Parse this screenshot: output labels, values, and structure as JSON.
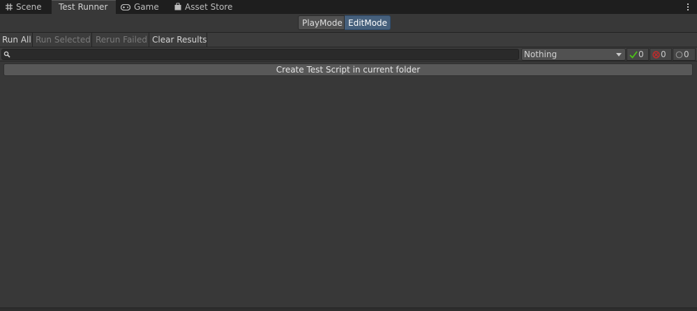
{
  "tabs": [
    {
      "label": "Scene",
      "icon": "grid-icon",
      "active": false
    },
    {
      "label": "Test Runner",
      "icon": "",
      "active": true
    },
    {
      "label": "Game",
      "icon": "gamepad-icon",
      "active": false
    },
    {
      "label": "Asset Store",
      "icon": "shopping-bag-icon",
      "active": false
    }
  ],
  "modes": {
    "playmode_label": "PlayMode",
    "editmode_label": "EditMode",
    "selected": "EditMode"
  },
  "toolbar": {
    "run_all": "Run All",
    "run_selected": "Run Selected",
    "rerun_failed": "Rerun Failed",
    "clear_results": "Clear Results"
  },
  "search": {
    "value": "",
    "placeholder": ""
  },
  "category_filter": {
    "selected": "Nothing"
  },
  "counters": {
    "passed": "0",
    "failed": "0",
    "not_run": "0"
  },
  "create_button": {
    "label": "Create Test Script in current folder"
  },
  "colors": {
    "selected_mode": "#46607c",
    "passed": "#4cc417",
    "failed": "#c82a2a"
  }
}
